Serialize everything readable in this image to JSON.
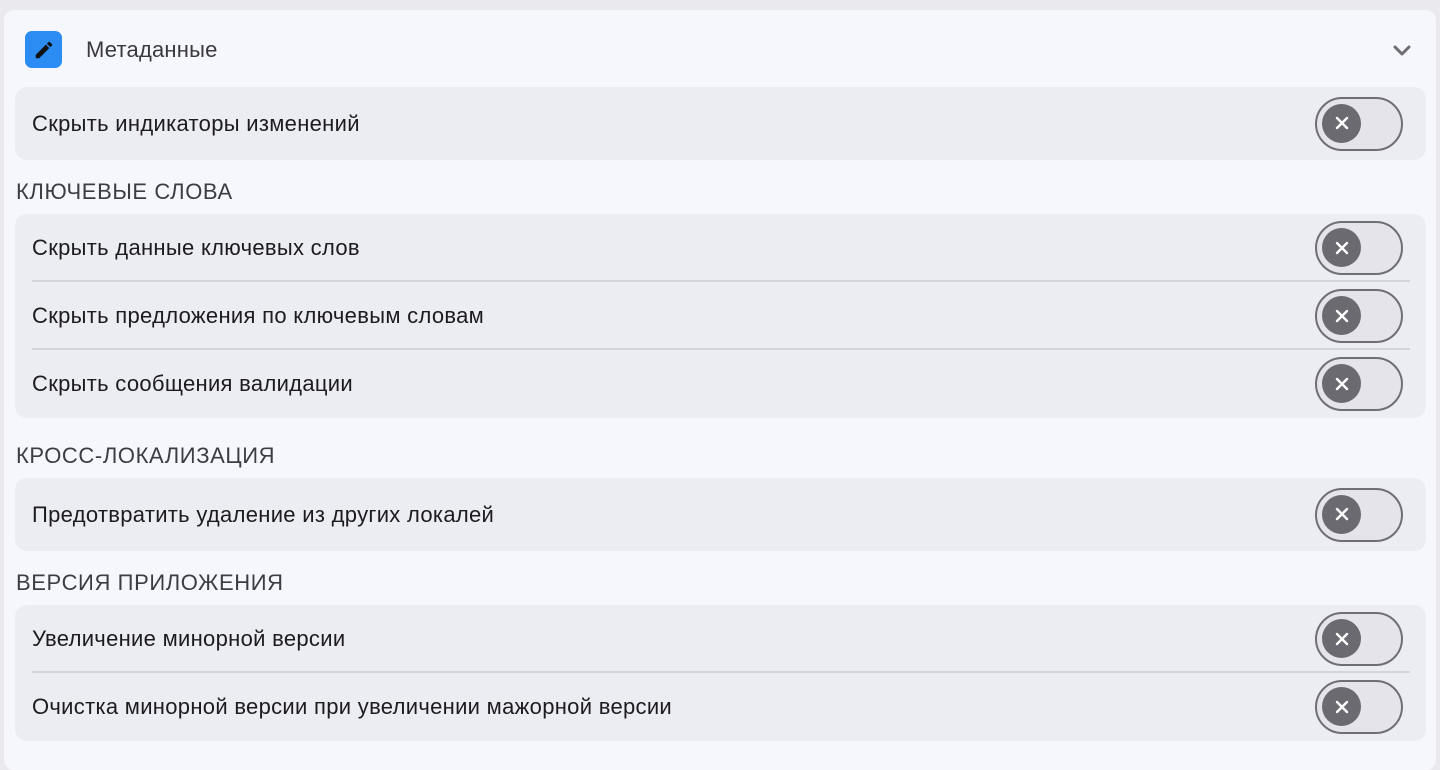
{
  "header": {
    "title": "Метаданные",
    "icon": "pencil-icon",
    "accent_color": "#2b8cf3",
    "collapse_icon": "chevron-down-icon"
  },
  "general": {
    "items": [
      {
        "label": "Скрыть индикаторы изменений",
        "enabled": false
      }
    ]
  },
  "keywords": {
    "title": "КЛЮЧЕВЫЕ СЛОВА",
    "items": [
      {
        "label": "Скрыть данные ключевых слов",
        "enabled": false
      },
      {
        "label": "Скрыть предложения по ключевым словам",
        "enabled": false
      },
      {
        "label": "Скрыть сообщения валидации",
        "enabled": false
      }
    ]
  },
  "cross_localization": {
    "title": "КРОСС-ЛОКАЛИЗАЦИЯ",
    "items": [
      {
        "label": "Предотвратить удаление из других локалей",
        "enabled": false
      }
    ]
  },
  "app_version": {
    "title": "ВЕРСИЯ ПРИЛОЖЕНИЯ",
    "items": [
      {
        "label": "Увеличение минорной версии",
        "enabled": false
      },
      {
        "label": "Очистка минорной версии при увеличении мажорной версии",
        "enabled": false
      }
    ]
  }
}
